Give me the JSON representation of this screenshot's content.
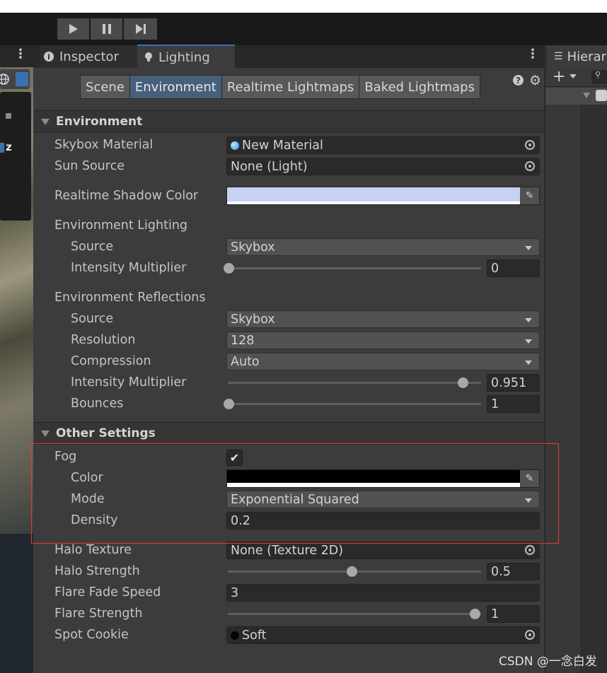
{
  "tabs": {
    "inspector": "Inspector",
    "lighting": "Lighting",
    "hierarchy": "Hierar"
  },
  "subtabs": [
    "Scene",
    "Environment",
    "Realtime Lightmaps",
    "Baked Lightmaps"
  ],
  "active_subtab": "Environment",
  "environment": {
    "header": "Environment",
    "skybox_material_label": "Skybox Material",
    "skybox_material_value": "New Material",
    "sun_source_label": "Sun Source",
    "sun_source_value": "None (Light)",
    "realtime_shadow_color_label": "Realtime Shadow Color",
    "realtime_shadow_color": "#c7d1f2",
    "env_lighting_label": "Environment Lighting",
    "lighting_source_label": "Source",
    "lighting_source_value": "Skybox",
    "lighting_intensity_label": "Intensity Multiplier",
    "lighting_intensity_value": "0",
    "env_reflections_label": "Environment Reflections",
    "reflection_source_label": "Source",
    "reflection_source_value": "Skybox",
    "resolution_label": "Resolution",
    "resolution_value": "128",
    "compression_label": "Compression",
    "compression_value": "Auto",
    "reflection_intensity_label": "Intensity Multiplier",
    "reflection_intensity_value": "0.951",
    "bounces_label": "Bounces",
    "bounces_value": "1"
  },
  "other": {
    "header": "Other Settings",
    "fog_label": "Fog",
    "fog_checked": true,
    "fog_color_label": "Color",
    "fog_color": "#000000",
    "fog_mode_label": "Mode",
    "fog_mode_value": "Exponential Squared",
    "fog_density_label": "Density",
    "fog_density_value": "0.2",
    "halo_texture_label": "Halo Texture",
    "halo_texture_value": "None (Texture 2D)",
    "halo_strength_label": "Halo Strength",
    "halo_strength_value": "0.5",
    "flare_fade_label": "Flare Fade Speed",
    "flare_fade_value": "3",
    "flare_strength_label": "Flare Strength",
    "flare_strength_value": "1",
    "spot_cookie_label": "Spot Cookie",
    "spot_cookie_value": "Soft"
  },
  "slider_levels": {
    "lighting_intensity": 0.0,
    "reflection_intensity": 0.951,
    "bounces": 0.0,
    "halo_strength": 0.5,
    "flare_strength": 1.0
  },
  "left_overlay_letter": "z",
  "watermark": "CSDN @一念白发",
  "colors": {
    "accent": "#46607c",
    "highlight_border": "#e23b3b"
  }
}
